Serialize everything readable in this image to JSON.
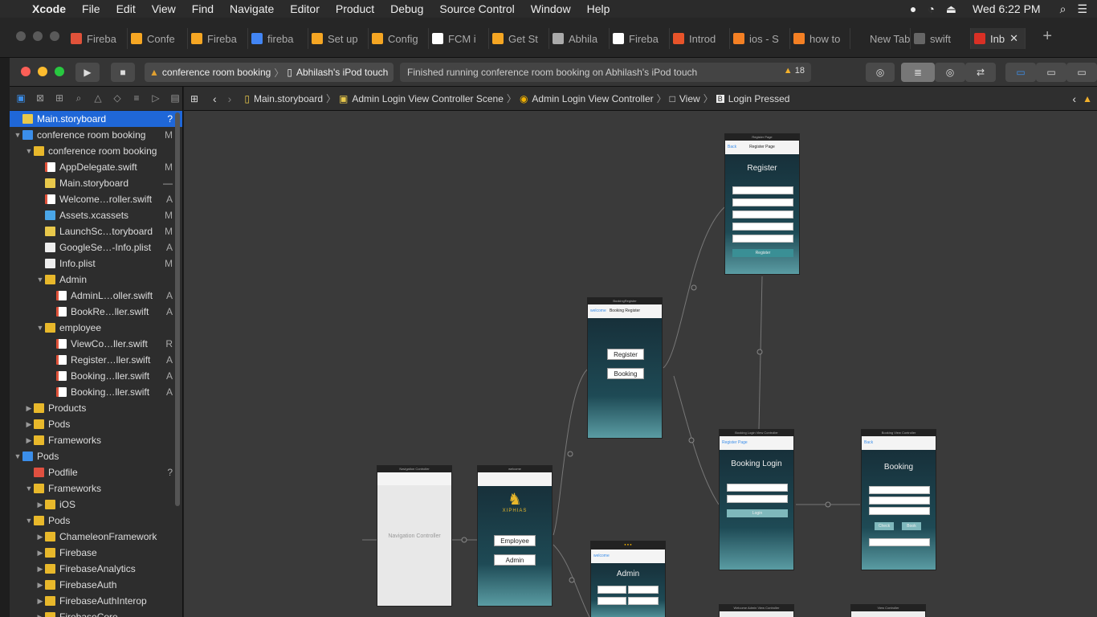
{
  "menubar": {
    "items": [
      "Xcode",
      "File",
      "Edit",
      "View",
      "Find",
      "Navigate",
      "Editor",
      "Product",
      "Debug",
      "Source Control",
      "Window",
      "Help"
    ],
    "clock": "Wed 6:22 PM"
  },
  "browser_tabs": [
    {
      "label": "Fireba",
      "icon_color": "#e0523a"
    },
    {
      "label": "Confe",
      "icon_color": "#f5a623"
    },
    {
      "label": "Fireba",
      "icon_color": "#f5a623"
    },
    {
      "label": "fireba",
      "icon_color": "#4285f4"
    },
    {
      "label": "Set up",
      "icon_color": "#f5a623"
    },
    {
      "label": "Config",
      "icon_color": "#f5a623"
    },
    {
      "label": "FCM i",
      "icon_color": "#ffffff"
    },
    {
      "label": "Get St",
      "icon_color": "#f5a623"
    },
    {
      "label": "Abhila",
      "icon_color": "#aaaaaa"
    },
    {
      "label": "Fireba",
      "icon_color": "#ffffff"
    },
    {
      "label": "Introd",
      "icon_color": "#e8542a"
    },
    {
      "label": "ios - S",
      "icon_color": "#f48024"
    },
    {
      "label": "how to",
      "icon_color": "#f48024"
    },
    {
      "label": "New Tab",
      "icon_color": ""
    },
    {
      "label": "swift",
      "icon_color": "#666666"
    },
    {
      "label": "Inb",
      "icon_color": "#d93025"
    }
  ],
  "toolbar": {
    "scheme": "conference room booking",
    "device": "Abhilash's iPod touch",
    "status": "Finished running conference room booking on Abhilash's iPod touch",
    "warning_count": "18"
  },
  "navigator": {
    "rows": [
      {
        "label": "Main.storyboard",
        "badge": "?",
        "depth": 0,
        "kind": "sb",
        "disc": "",
        "selected": true
      },
      {
        "label": "conference room booking",
        "badge": "M",
        "depth": 0,
        "kind": "proj",
        "disc": "▼",
        "selected": false
      },
      {
        "label": "conference room booking",
        "badge": "",
        "depth": 1,
        "kind": "fold",
        "disc": "▼",
        "selected": false
      },
      {
        "label": "AppDelegate.swift",
        "badge": "M",
        "depth": 2,
        "kind": "swift",
        "disc": "",
        "selected": false
      },
      {
        "label": "Main.storyboard",
        "badge": "—",
        "depth": 2,
        "kind": "sb",
        "disc": "",
        "selected": false
      },
      {
        "label": "Welcome…roller.swift",
        "badge": "A",
        "depth": 2,
        "kind": "swift",
        "disc": "",
        "selected": false
      },
      {
        "label": "Assets.xcassets",
        "badge": "M",
        "depth": 2,
        "kind": "assets",
        "disc": "",
        "selected": false
      },
      {
        "label": "LaunchSc…toryboard",
        "badge": "M",
        "depth": 2,
        "kind": "sb",
        "disc": "",
        "selected": false
      },
      {
        "label": "GoogleSe…-Info.plist",
        "badge": "A",
        "depth": 2,
        "kind": "plist",
        "disc": "",
        "selected": false
      },
      {
        "label": "Info.plist",
        "badge": "M",
        "depth": 2,
        "kind": "plist",
        "disc": "",
        "selected": false
      },
      {
        "label": "Admin",
        "badge": "",
        "depth": 2,
        "kind": "fold",
        "disc": "▼",
        "selected": false
      },
      {
        "label": "AdminL…oller.swift",
        "badge": "A",
        "depth": 3,
        "kind": "swift",
        "disc": "",
        "selected": false
      },
      {
        "label": "BookRe…ller.swift",
        "badge": "A",
        "depth": 3,
        "kind": "swift",
        "disc": "",
        "selected": false
      },
      {
        "label": "employee",
        "badge": "",
        "depth": 2,
        "kind": "fold",
        "disc": "▼",
        "selected": false
      },
      {
        "label": "ViewCo…ller.swift",
        "badge": "R",
        "depth": 3,
        "kind": "swift",
        "disc": "",
        "selected": false
      },
      {
        "label": "Register…ller.swift",
        "badge": "A",
        "depth": 3,
        "kind": "swift",
        "disc": "",
        "selected": false
      },
      {
        "label": "Booking…ller.swift",
        "badge": "A",
        "depth": 3,
        "kind": "swift",
        "disc": "",
        "selected": false
      },
      {
        "label": "Booking…ller.swift",
        "badge": "A",
        "depth": 3,
        "kind": "swift",
        "disc": "",
        "selected": false
      },
      {
        "label": "Products",
        "badge": "",
        "depth": 1,
        "kind": "fold",
        "disc": "▶",
        "selected": false
      },
      {
        "label": "Pods",
        "badge": "",
        "depth": 1,
        "kind": "fold",
        "disc": "▶",
        "selected": false
      },
      {
        "label": "Frameworks",
        "badge": "",
        "depth": 1,
        "kind": "fold",
        "disc": "▶",
        "selected": false
      },
      {
        "label": "Pods",
        "badge": "",
        "depth": 0,
        "kind": "proj",
        "disc": "▼",
        "selected": false
      },
      {
        "label": "Podfile",
        "badge": "?",
        "depth": 1,
        "kind": "pod",
        "disc": "",
        "selected": false
      },
      {
        "label": "Frameworks",
        "badge": "",
        "depth": 1,
        "kind": "fold",
        "disc": "▼",
        "selected": false
      },
      {
        "label": "iOS",
        "badge": "",
        "depth": 2,
        "kind": "fold",
        "disc": "▶",
        "selected": false
      },
      {
        "label": "Pods",
        "badge": "",
        "depth": 1,
        "kind": "fold",
        "disc": "▼",
        "selected": false
      },
      {
        "label": "ChameleonFramework",
        "badge": "",
        "depth": 2,
        "kind": "fold",
        "disc": "▶",
        "selected": false
      },
      {
        "label": "Firebase",
        "badge": "",
        "depth": 2,
        "kind": "fold",
        "disc": "▶",
        "selected": false
      },
      {
        "label": "FirebaseAnalytics",
        "badge": "",
        "depth": 2,
        "kind": "fold",
        "disc": "▶",
        "selected": false
      },
      {
        "label": "FirebaseAuth",
        "badge": "",
        "depth": 2,
        "kind": "fold",
        "disc": "▶",
        "selected": false
      },
      {
        "label": "FirebaseAuthInterop",
        "badge": "",
        "depth": 2,
        "kind": "fold",
        "disc": "▶",
        "selected": false
      },
      {
        "label": "FirebaseCore",
        "badge": "",
        "depth": 2,
        "kind": "fold",
        "disc": "▶",
        "selected": false
      }
    ]
  },
  "jumpbar": {
    "crumbs": [
      "Main.storyboard",
      "Admin Login View Controller Scene",
      "Admin Login View Controller",
      "View",
      "Login Pressed"
    ]
  },
  "storyboard": {
    "nav_controller": {
      "title": "Navigation Controller",
      "label": "Navigation Controller"
    },
    "welcome": {
      "title": "welcome",
      "logo": "XIPHIAS",
      "buttons": [
        "Employee",
        "Admin"
      ]
    },
    "booking_register": {
      "title": "BookingRegister",
      "nav": "Booking Register",
      "back": "welcome",
      "buttons": [
        "Register",
        "Booking"
      ]
    },
    "register_page": {
      "title": "Register Page",
      "nav": "Register Page",
      "back": "Back",
      "heading": "Register",
      "submit": "Register"
    },
    "booking_login": {
      "title": "Booking Login View Controller",
      "back": "Register Page",
      "heading": "Booking Login",
      "submit": "Login"
    },
    "booking_vc": {
      "title": "Booking View Controller",
      "back": "Back",
      "heading": "Booking",
      "buttons": [
        "Check",
        "Book"
      ]
    },
    "admin_vc": {
      "back": "welcome",
      "heading": "Admin"
    },
    "welcome_admin": {
      "title": "Welcome Admin View Controller"
    },
    "view_controller": {
      "title": "View Controller"
    }
  }
}
